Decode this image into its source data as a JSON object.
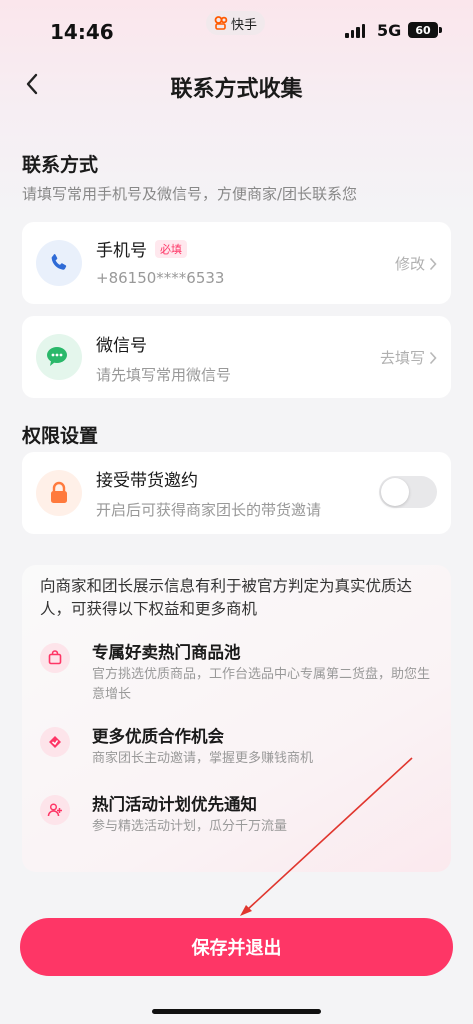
{
  "status_bar": {
    "time": "14:46",
    "app_name": "快手",
    "network": "5G",
    "battery": "60",
    "brand_color": "#ff5a00"
  },
  "nav": {
    "title": "联系方式收集",
    "back_icon": "chevron-left-icon"
  },
  "contact_section": {
    "title": "联系方式",
    "subtitle": "请填写常用手机号及微信号，方便商家/团长联系您",
    "phone": {
      "label": "手机号",
      "badge": "必填",
      "value": "+86150****6533",
      "action": "修改",
      "icon": "phone-icon",
      "icon_color": "#2f6bd6"
    },
    "wechat": {
      "label": "微信号",
      "placeholder": "请先填写常用微信号",
      "action": "去填写",
      "icon": "wechat-icon",
      "icon_color": "#2ab86a"
    }
  },
  "permission_section": {
    "title": "权限设置",
    "item": {
      "label": "接受带货邀约",
      "description": "开启后可获得商家团长的带货邀请",
      "enabled": false,
      "icon": "lock-icon",
      "icon_color": "#ff7a3d"
    }
  },
  "benefits": {
    "intro": "向商家和团长展示信息有利于被官方判定为真实优质达人，可获得以下权益和更多商机",
    "items": [
      {
        "title": "专属好卖热门商品池",
        "description": "官方挑选优质商品，工作台选品中心专属第二货盘，助您生意增长",
        "icon": "shopping-bag-icon"
      },
      {
        "title": "更多优质合作机会",
        "description": "商家团长主动邀请，掌握更多赚钱商机",
        "icon": "handshake-icon"
      },
      {
        "title": "热门活动计划优先通知",
        "description": "参与精选活动计划，瓜分千万流量",
        "icon": "user-add-icon"
      }
    ]
  },
  "footer": {
    "save_label": "保存并退出",
    "accent_color": "#fe3666"
  }
}
